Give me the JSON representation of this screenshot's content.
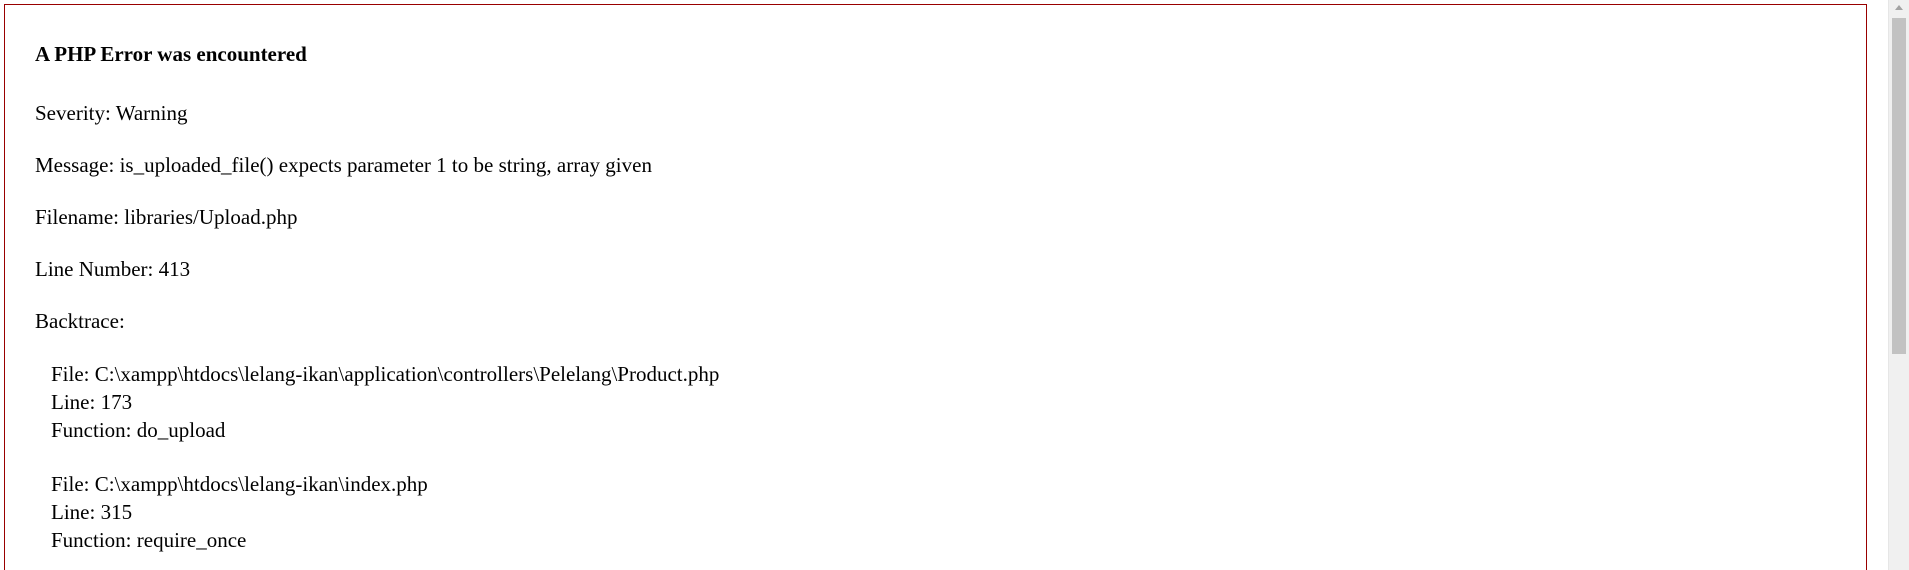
{
  "error": {
    "title": "A PHP Error was encountered",
    "severity": "Severity: Warning",
    "message": "Message: is_uploaded_file() expects parameter 1 to be string, array given",
    "filename": "Filename: libraries/Upload.php",
    "line_number": "Line Number: 413",
    "backtrace_label": "Backtrace:",
    "backtrace": [
      {
        "file": "File: C:\\xampp\\htdocs\\lelang-ikan\\application\\controllers\\Pelelang\\Product.php",
        "line": "Line: 173",
        "function": "Function: do_upload"
      },
      {
        "file": "File: C:\\xampp\\htdocs\\lelang-ikan\\index.php",
        "line": "Line: 315",
        "function": "Function: require_once"
      }
    ]
  },
  "colors": {
    "border": "#990000",
    "scrollbar_track": "#f0f0f0",
    "scrollbar_thumb": "#c2c2c2"
  }
}
